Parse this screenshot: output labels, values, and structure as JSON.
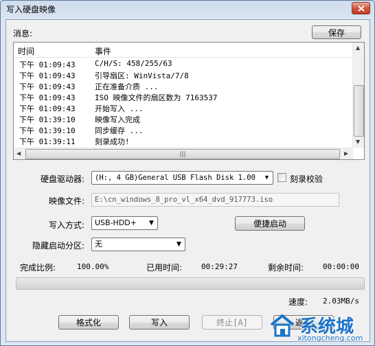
{
  "window": {
    "title": "写入硬盘映像",
    "close_icon": "close-icon"
  },
  "messages": {
    "label": "消息:",
    "save_label": "保存"
  },
  "log": {
    "columns": [
      "时间",
      "事件"
    ],
    "rows": [
      {
        "time": "下午 01:09:43",
        "event": "C/H/S: 458/255/63"
      },
      {
        "time": "下午 01:09:43",
        "event": "引导扇区: WinVista/7/8"
      },
      {
        "time": "下午 01:09:43",
        "event": "正在准备介质 ..."
      },
      {
        "time": "下午 01:09:43",
        "event": "ISO 映像文件的扇区数为 7163537"
      },
      {
        "time": "下午 01:09:43",
        "event": "开始写入 ..."
      },
      {
        "time": "下午 01:39:10",
        "event": "映像写入完成"
      },
      {
        "time": "下午 01:39:10",
        "event": "同步缓存 ..."
      },
      {
        "time": "下午 01:39:11",
        "event": "刻录成功!"
      }
    ]
  },
  "form": {
    "drive_label": "硬盘驱动器:",
    "drive_value": "(H:, 4 GB)General USB Flash Disk  1.00",
    "verify_label": "刻录校验",
    "image_label": "映像文件:",
    "image_value": "E:\\cn_windows_8_pro_vl_x64_dvd_917773.iso",
    "write_mode_label": "写入方式:",
    "write_mode_value": "USB-HDD+",
    "quick_boot_label": "便捷启动",
    "hidden_partition_label": "隐藏启动分区:",
    "hidden_partition_value": "无"
  },
  "stats": {
    "complete_label": "完成比例:",
    "complete_value": "100.00%",
    "elapsed_label": "已用时间:",
    "elapsed_value": "00:29:27",
    "remaining_label": "剩余时间:",
    "remaining_value": "00:00:00",
    "speed_label": "速度:",
    "speed_value": "2.03MB/s",
    "progress_fraction": 1.0
  },
  "buttons": {
    "format_label": "格式化",
    "write_label": "写入",
    "abort_label": "终止[A]",
    "back_label": "返回"
  },
  "watermark": {
    "brand": "系统城",
    "url": "xitongcheng.com"
  },
  "colors": {
    "title_bar": "#cfdcec",
    "close_button": "#c23b22",
    "client_bg": "#f0f0f0",
    "watermark_blue": "#1a73c8"
  }
}
